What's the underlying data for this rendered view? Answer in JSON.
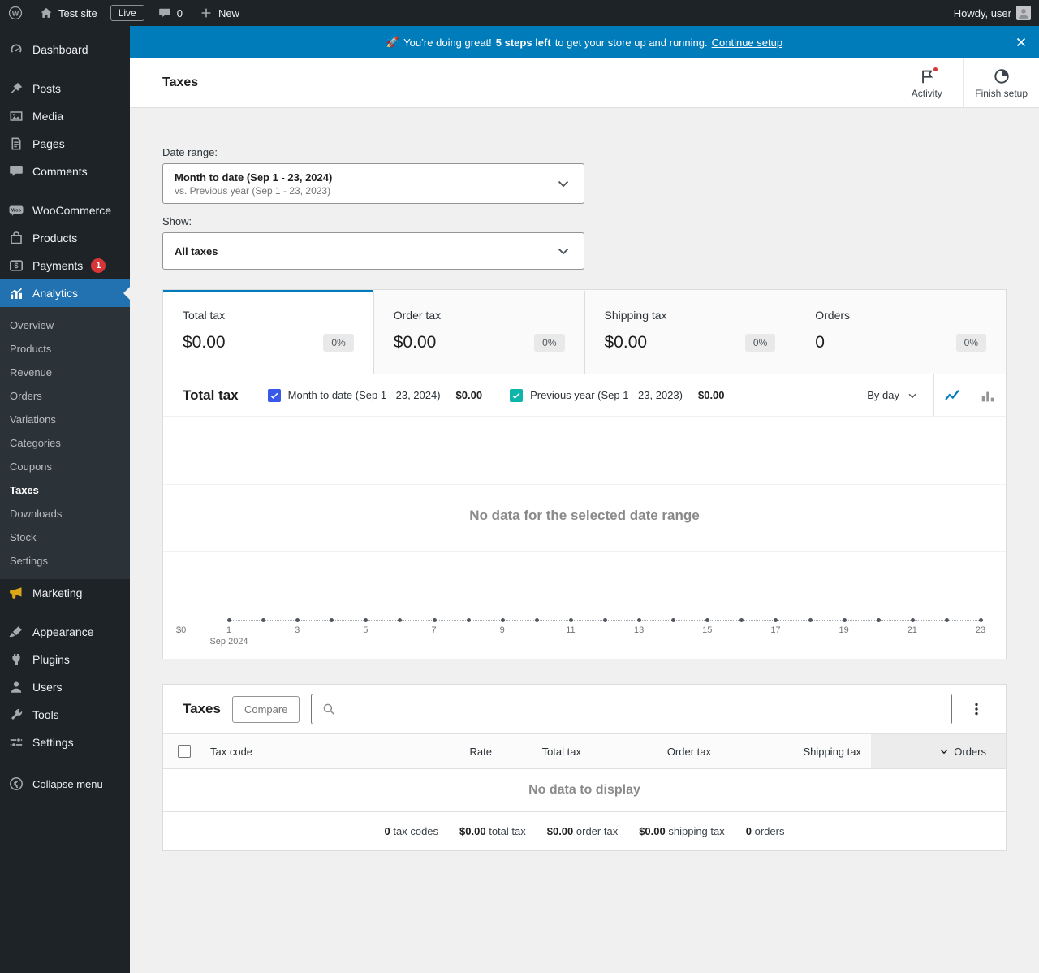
{
  "admin_bar": {
    "site_name": "Test site",
    "live_badge": "Live",
    "comment_count": "0",
    "new_label": "New",
    "howdy": "Howdy, user"
  },
  "sidebar": {
    "items": [
      {
        "label": "Dashboard",
        "icon": "dashboard",
        "separator_after": true
      },
      {
        "label": "Posts",
        "icon": "posts"
      },
      {
        "label": "Media",
        "icon": "media"
      },
      {
        "label": "Pages",
        "icon": "pages"
      },
      {
        "label": "Comments",
        "icon": "comments",
        "separator_after": true
      },
      {
        "label": "WooCommerce",
        "icon": "woocommerce"
      },
      {
        "label": "Products",
        "icon": "products"
      },
      {
        "label": "Payments",
        "icon": "payments",
        "badge": "1"
      },
      {
        "label": "Analytics",
        "icon": "analytics",
        "active": true,
        "submenu": [
          "Overview",
          "Products",
          "Revenue",
          "Orders",
          "Variations",
          "Categories",
          "Coupons",
          "Taxes",
          "Downloads",
          "Stock",
          "Settings"
        ],
        "current_submenu": "Taxes"
      },
      {
        "label": "Marketing",
        "icon": "marketing",
        "separator_after": true
      },
      {
        "label": "Appearance",
        "icon": "appearance"
      },
      {
        "label": "Plugins",
        "icon": "plugins"
      },
      {
        "label": "Users",
        "icon": "users"
      },
      {
        "label": "Tools",
        "icon": "tools"
      },
      {
        "label": "Settings",
        "icon": "settings"
      }
    ],
    "collapse_label": "Collapse menu"
  },
  "banner": {
    "emoji": "🚀",
    "text_1": "You’re doing great!",
    "steps": "5 steps left",
    "text_2": "to get your store up and running.",
    "link": "Continue setup"
  },
  "header": {
    "title": "Taxes",
    "activity_label": "Activity",
    "finish_setup_label": "Finish setup"
  },
  "filters": {
    "date_range_label": "Date range:",
    "date_range_primary": "Month to date (Sep 1 - 23, 2024)",
    "date_range_secondary": "vs. Previous year (Sep 1 - 23, 2023)",
    "show_label": "Show:",
    "show_value": "All taxes"
  },
  "stats": [
    {
      "label": "Total tax",
      "value": "$0.00",
      "delta": "0%",
      "selected": true
    },
    {
      "label": "Order tax",
      "value": "$0.00",
      "delta": "0%",
      "selected": false
    },
    {
      "label": "Shipping tax",
      "value": "$0.00",
      "delta": "0%",
      "selected": false
    },
    {
      "label": "Orders",
      "value": "0",
      "delta": "0%",
      "selected": false
    }
  ],
  "chart_data": {
    "type": "line",
    "title": "Total tax",
    "interval": "By day",
    "empty_message": "No data for the selected date range",
    "x_unit": "day",
    "x": [
      1,
      2,
      3,
      4,
      5,
      6,
      7,
      8,
      9,
      10,
      11,
      12,
      13,
      14,
      15,
      16,
      17,
      18,
      19,
      20,
      21,
      22,
      23
    ],
    "x_tick_labels": [
      "1",
      "3",
      "5",
      "7",
      "9",
      "11",
      "13",
      "15",
      "17",
      "19",
      "21",
      "23"
    ],
    "x_axis_secondary_label": "Sep 2024",
    "y_tick_labels": [
      "$0"
    ],
    "series": [
      {
        "name": "Month to date (Sep 1 - 23, 2024)",
        "total": "$0.00",
        "color": "#3858e9",
        "values": []
      },
      {
        "name": "Previous year (Sep 1 - 23, 2023)",
        "total": "$0.00",
        "color": "#0cb4aa",
        "values": []
      }
    ],
    "legend_position": "top",
    "grid": true
  },
  "table": {
    "title": "Taxes",
    "compare_label": "Compare",
    "search_placeholder": "",
    "columns": [
      "Tax code",
      "Rate",
      "Total tax",
      "Order tax",
      "Shipping tax",
      "Orders"
    ],
    "sorted_column": "Orders",
    "sort_direction": "desc",
    "empty_message": "No data to display",
    "summary": [
      {
        "value": "0",
        "label": "tax codes"
      },
      {
        "value": "$0.00",
        "label": "total tax"
      },
      {
        "value": "$0.00",
        "label": "order tax"
      },
      {
        "value": "$0.00",
        "label": "shipping tax"
      },
      {
        "value": "0",
        "label": "orders"
      }
    ]
  },
  "colors": {
    "accent": "#2271b1",
    "banner": "#007cba",
    "notification_badge": "#d63638",
    "series_primary": "#3858e9",
    "series_secondary": "#0cb4aa"
  }
}
